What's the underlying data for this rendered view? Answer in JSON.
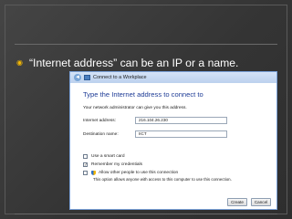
{
  "slide": {
    "bullet_glyph": "◉",
    "bullet_text": "“Internet address” can be an IP or a name."
  },
  "dialog": {
    "title": "Connect to a Workplace",
    "heading": "Type the Internet address to connect to",
    "description": "Your network administrator can give you this address.",
    "internet_address_label": "Internet address:",
    "internet_address_value": "216.104.26.230",
    "destination_name_label": "Destination name:",
    "destination_name_value": "IICT",
    "use_smart_card_label": "Use a smart card",
    "use_smart_card_checked": false,
    "remember_credentials_label": "Remember my credentials",
    "remember_credentials_checked": true,
    "allow_others_label": "Allow other people to use this connection",
    "allow_others_checked": false,
    "allow_others_description": "This option allows anyone with access to this computer to use this connection.",
    "create_button": "Create",
    "cancel_button": "Cancel"
  },
  "colors": {
    "bullet": "#f2b705",
    "heading": "#1e3c96",
    "background": "#3b3b3b"
  },
  "icons": [
    "back-arrow-icon",
    "network-icon",
    "shield-icon"
  ]
}
